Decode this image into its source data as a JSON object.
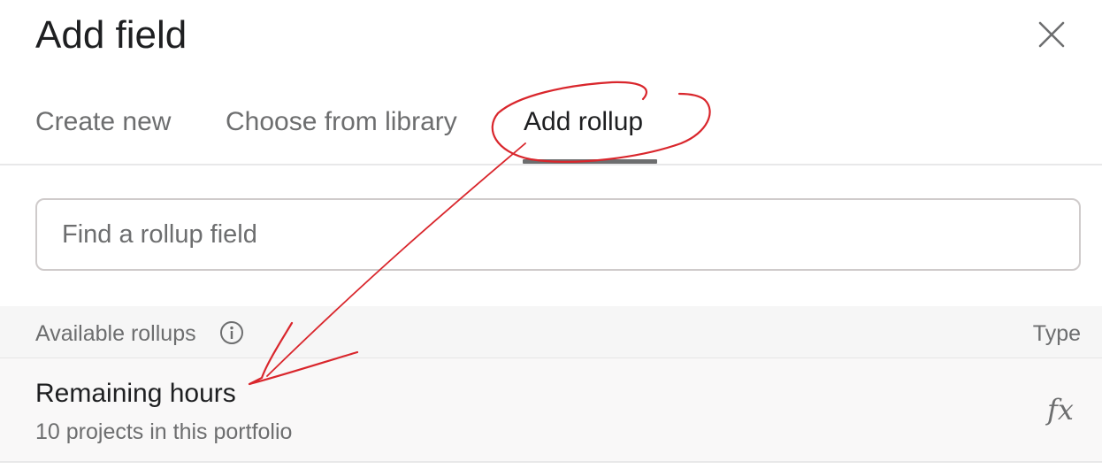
{
  "dialog": {
    "title": "Add field",
    "close_icon": "close-icon"
  },
  "tabs": [
    {
      "label": "Create new",
      "active": false
    },
    {
      "label": "Choose from library",
      "active": false
    },
    {
      "label": "Add rollup",
      "active": true
    }
  ],
  "search": {
    "placeholder": "Find a rollup field",
    "value": ""
  },
  "list": {
    "header_label": "Available rollups",
    "header_icon": "info-icon",
    "type_label": "Type",
    "items": [
      {
        "title": "Remaining hours",
        "subtitle": "10 projects in this portfolio",
        "type_icon": "fx-icon",
        "type_glyph": "fx"
      }
    ]
  },
  "colors": {
    "annotation": "#d9262c",
    "text_primary": "#1e1f21",
    "text_secondary": "#6d6e6f",
    "active_tab_underline": "#6d6e6f"
  }
}
